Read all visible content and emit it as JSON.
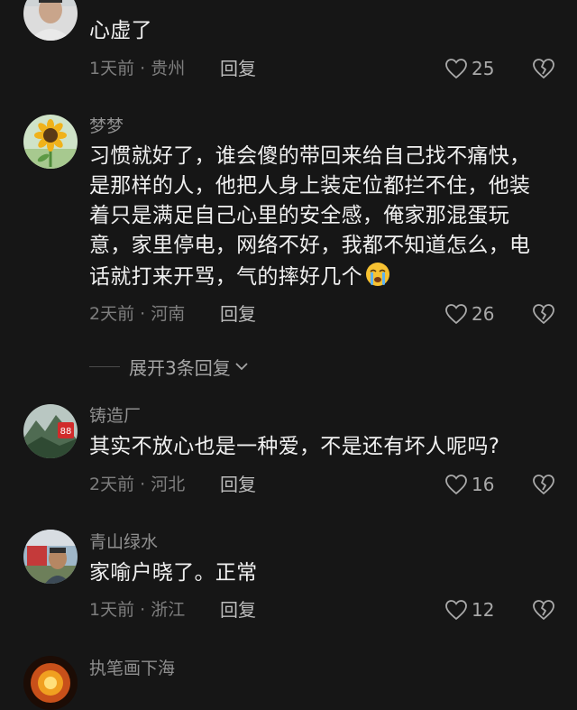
{
  "comments": [
    {
      "username": "",
      "text": "心虚了",
      "meta": "1天前 · 贵州",
      "reply": "回复",
      "likes": "25",
      "avatar": "person-avatar"
    },
    {
      "username": "梦梦",
      "text": "习惯就好了，谁会傻的带回来给自己找不痛快，是那样的人，他把人身上装定位都拦不住，他装着只是满足自己心里的安全感，俺家那混蛋玩意，家里停电，网络不好，我都不知道怎么，电话就打来开骂，气的摔好几个",
      "emoji": "crying-face-emoji",
      "meta": "2天前 · 河南",
      "reply": "回复",
      "likes": "26",
      "avatar": "sunflower-avatar"
    },
    {
      "username": "铸造厂",
      "text": "其实不放心也是一种爱，不是还有坏人呢吗?",
      "meta": "2天前 · 河北",
      "reply": "回复",
      "likes": "16",
      "avatar": "mountain-avatar"
    },
    {
      "username": "青山绿水",
      "text": "家喻户晓了。正常",
      "meta": "1天前 · 浙江",
      "reply": "回复",
      "likes": "12",
      "avatar": "man-avatar"
    },
    {
      "username": "执笔画下海",
      "avatar": "fire-avatar"
    }
  ],
  "expand_replies": {
    "label": "展开3条回复"
  },
  "colors": {
    "background": "#161616",
    "text": "#f0f0f0",
    "username": "#8f8f8f",
    "meta": "#7e7e7e"
  }
}
